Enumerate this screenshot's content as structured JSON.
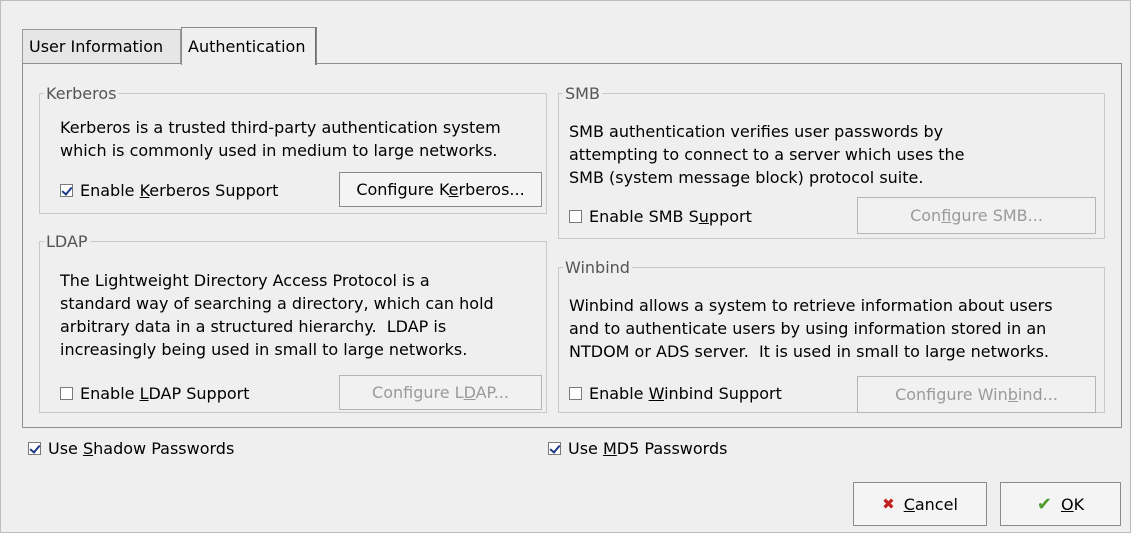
{
  "tabs": {
    "user_information": "User Information",
    "authentication": "Authentication"
  },
  "kerberos": {
    "legend": "Kerberos",
    "description": "Kerberos is a trusted third-party authentication system\nwhich is commonly used in medium to large networks.",
    "enable": {
      "pre": "Enable ",
      "key": "K",
      "post": "erberos Support",
      "checked": true
    },
    "configure": {
      "pre": "Configure K",
      "key": "e",
      "post": "rberos...",
      "enabled": true
    }
  },
  "ldap": {
    "legend": "LDAP",
    "description": "The Lightweight Directory Access Protocol is a\nstandard way of searching a directory, which can hold\narbitrary data in a structured hierarchy.  LDAP is\nincreasingly being used in small to large networks.",
    "enable": {
      "pre": "Enable ",
      "key": "L",
      "post": "DAP Support",
      "checked": false
    },
    "configure": {
      "pre": "Configure L",
      "key": "D",
      "post": "AP...",
      "enabled": false
    }
  },
  "smb": {
    "legend": "SMB",
    "description": "SMB authentication verifies user passwords by\nattempting to connect to a server which uses the\nSMB (system message block) protocol suite.",
    "enable": {
      "pre": "Enable SMB S",
      "key": "u",
      "post": "pport",
      "checked": false
    },
    "configure": {
      "pre": "Con",
      "key": "f",
      "post": "igure SMB...",
      "enabled": false
    }
  },
  "winbind": {
    "legend": "Winbind",
    "description": "Winbind allows a system to retrieve information about users\nand to authenticate users by using information stored in an\nNTDOM or ADS server.  It is used in small to large networks.",
    "enable": {
      "pre": "Enable ",
      "key": "W",
      "post": "inbind Support",
      "checked": false
    },
    "configure": {
      "pre": "Configure Win",
      "key": "b",
      "post": "ind...",
      "enabled": false
    }
  },
  "shadow": {
    "pre": "Use ",
    "key": "S",
    "post": "hadow Passwords",
    "checked": true
  },
  "md5": {
    "pre": "Use ",
    "key": "M",
    "post": "D5 Passwords",
    "checked": true
  },
  "buttons": {
    "cancel": {
      "key": "C",
      "post": "ancel",
      "icon": "cancel-x-icon"
    },
    "ok": {
      "key": "O",
      "post": "K",
      "icon": "checkmark-icon"
    }
  },
  "colors": {
    "cancel_icon": "#c21f1f",
    "ok_icon": "#4f9b2d",
    "check_mark": "#1c3a8a"
  }
}
